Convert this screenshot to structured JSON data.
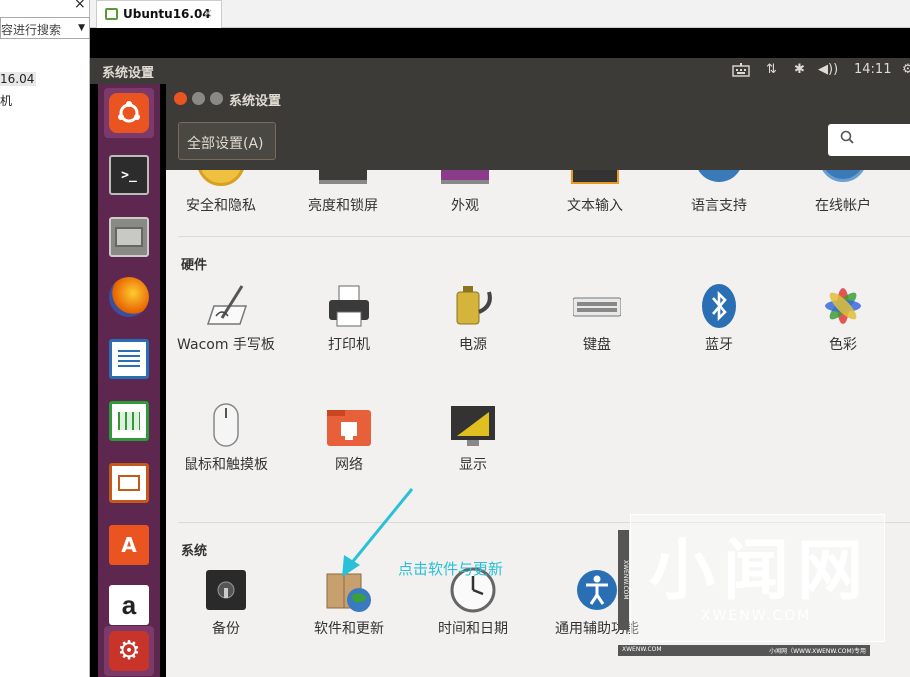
{
  "host": {
    "close_glyph": "×",
    "search_placeholder": "容进行搜索",
    "dropdown_glyph": "▼",
    "tree_items": [
      "16.04",
      "机"
    ],
    "tab_label": "Ubuntu16.04",
    "tab_close": "×"
  },
  "panel": {
    "title": "系统设置",
    "time": "14:11"
  },
  "launcher": [
    "ubuntu-dash",
    "terminal",
    "files",
    "firefox",
    "libreoffice-writer",
    "libreoffice-calc",
    "libreoffice-impress",
    "software-center",
    "amazon",
    "system-settings"
  ],
  "window": {
    "title": "系统设置",
    "all_settings_button": "全部设置(A)",
    "search_glyph": "🔍"
  },
  "personal_row": [
    "安全和隐私",
    "亮度和锁屏",
    "外观",
    "文本输入",
    "语言支持",
    "在线帐户"
  ],
  "hardware": {
    "title": "硬件",
    "items": [
      "Wacom 手写板",
      "打印机",
      "电源",
      "键盘",
      "蓝牙",
      "色彩",
      "鼠标和触摸板",
      "网络",
      "显示"
    ]
  },
  "system": {
    "title": "系统",
    "items": [
      "备份",
      "软件和更新",
      "时间和日期",
      "通用辅助功能"
    ]
  },
  "annotation": {
    "text": "点击软件与更新"
  },
  "watermark": {
    "big": "小闻网",
    "url": "XWENW.COM",
    "strip_left": "XWENW.COM",
    "strip_right": "小闻网（WWW.XWENW.COM)专用",
    "side": "XWENW.COM"
  },
  "colors": {
    "panel": "#3c3b37",
    "launcher": "#5e2750",
    "content_bg": "#f2f1f0",
    "annotation": "#2ac0d8",
    "close_button": "#e95420"
  }
}
